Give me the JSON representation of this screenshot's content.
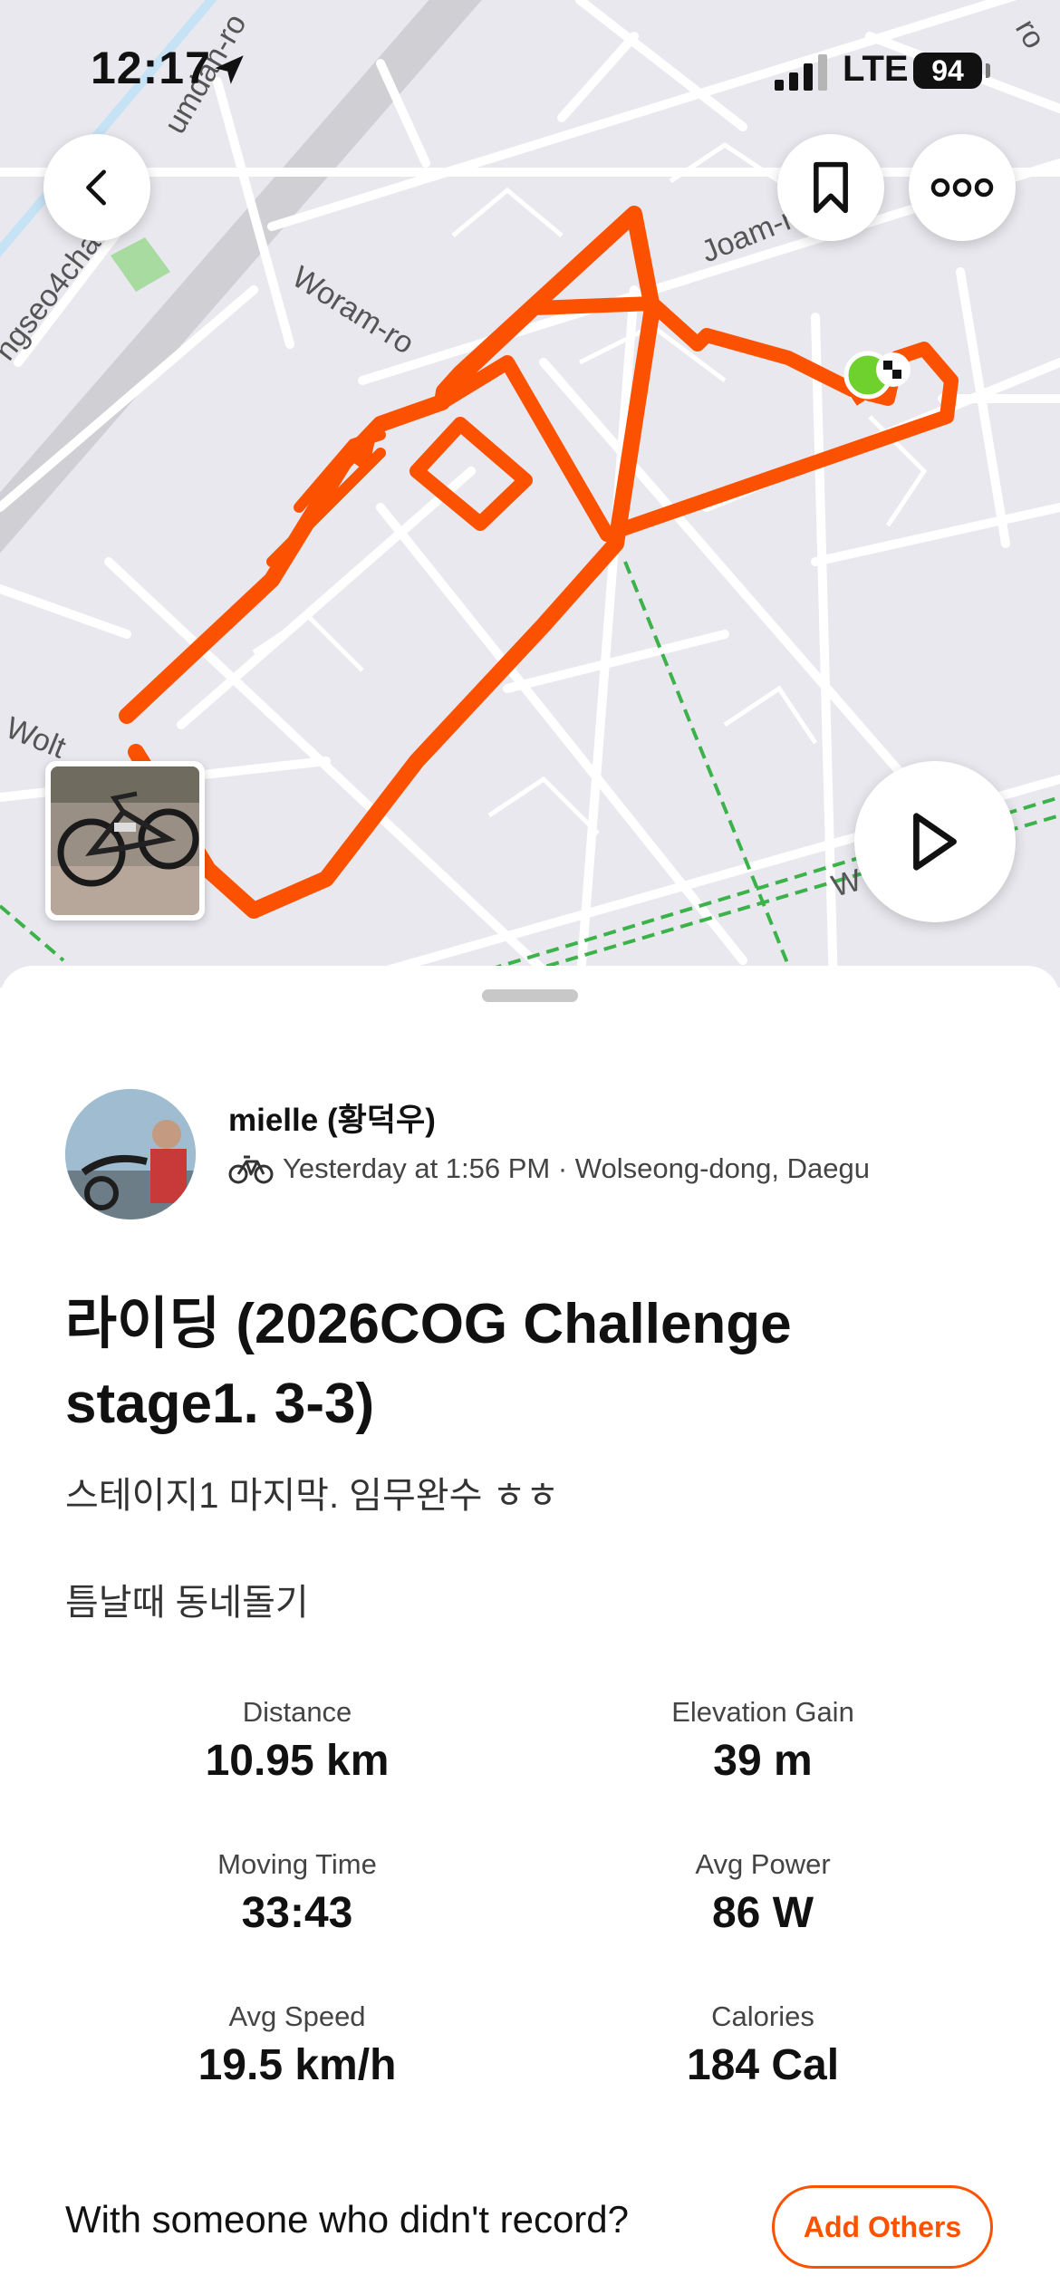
{
  "status_bar": {
    "time": "12:17",
    "network": "LTE",
    "battery": "94"
  },
  "map": {
    "street_labels": [
      "Woram-ro",
      "Joam-r",
      "ngseo4cha",
      "umdan-ro",
      "Wolt",
      "W",
      "ro"
    ],
    "route_color": "#fc5200",
    "start_color": "#6fd12e"
  },
  "activity": {
    "athlete_name": "mielle (황덕우)",
    "meta": "Yesterday at 1:56 PM · Wolseong-dong, Daegu",
    "title": "라이딩 (2026COG Challenge stage1. 3-3)",
    "description_1": "스테이지1 마지막. 임무완수 ㅎㅎ",
    "description_2": "틈날때 동네돌기"
  },
  "stats": [
    {
      "label": "Distance",
      "value": "10.95 km"
    },
    {
      "label": "Elevation Gain",
      "value": "39 m"
    },
    {
      "label": "Moving Time",
      "value": "33:43"
    },
    {
      "label": "Avg Power",
      "value": "86 W"
    },
    {
      "label": "Avg Speed",
      "value": "19.5 km/h"
    },
    {
      "label": "Calories",
      "value": "184 Cal"
    }
  ],
  "footer": {
    "with_text": "With someone who didn't record?",
    "add_others_label": "Add Others"
  },
  "icons": {
    "back": "chevron-left-icon",
    "bookmark": "bookmark-icon",
    "more": "more-dots-icon",
    "play": "play-icon",
    "sport": "bike-icon"
  },
  "colors": {
    "accent": "#fc5200"
  }
}
